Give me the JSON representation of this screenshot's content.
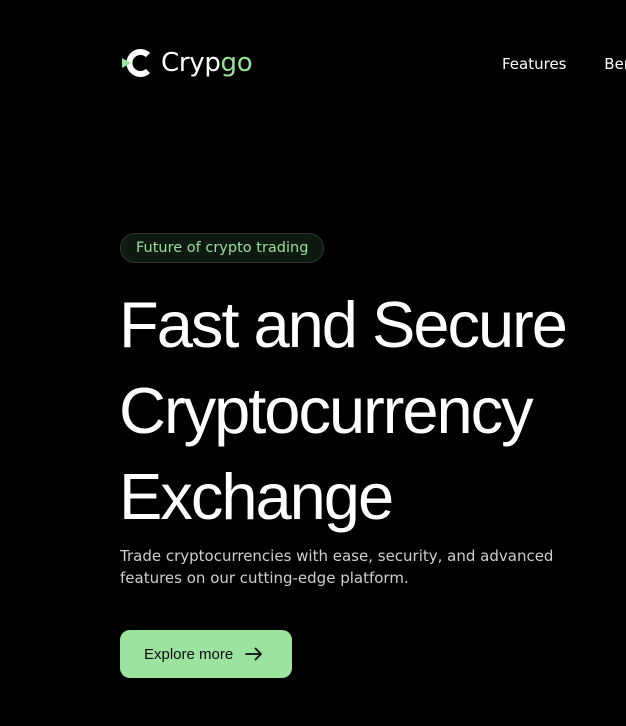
{
  "brand": {
    "name_prefix": "Cryp",
    "name_suffix": "go",
    "accent_color": "#9bdf9c"
  },
  "nav": {
    "items": [
      {
        "label": "Features"
      },
      {
        "label": "Bene"
      }
    ]
  },
  "hero": {
    "tag": "Future of crypto trading",
    "headline_lines": [
      "Fast and Secure",
      "Cryptocurrency",
      "Exchange"
    ],
    "subtext": "Trade cryptocurrencies with ease, security, and advanced features on our cutting-edge platform.",
    "cta_label": "Explore more",
    "cta_icon": "arrow-right-icon",
    "cta_color": "#9de3a0"
  },
  "colors": {
    "background": "#000000",
    "text": "#ffffff",
    "muted_text": "#cfcfcf"
  }
}
